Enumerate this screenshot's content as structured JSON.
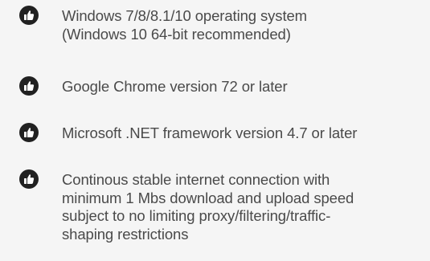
{
  "requirements": {
    "icon": "thumbs-up-icon",
    "icon_color": "#212121",
    "text_color": "#4a4a4a",
    "background_color": "#f5f5f5",
    "items": [
      {
        "lines": [
          "Windows 7/8/8.1/10 operating system",
          "(Windows 10 64-bit recommended)"
        ]
      },
      {
        "lines": [
          "Google Chrome version 72 or later"
        ]
      },
      {
        "lines": [
          "Microsoft .NET framework version 4.7 or later"
        ]
      },
      {
        "lines": [
          "Continous stable internet connection with",
          "minimum 1 Mbs download and upload speed",
          "subject to no limiting proxy/filtering/traffic-",
          "shaping restrictions"
        ]
      }
    ]
  }
}
